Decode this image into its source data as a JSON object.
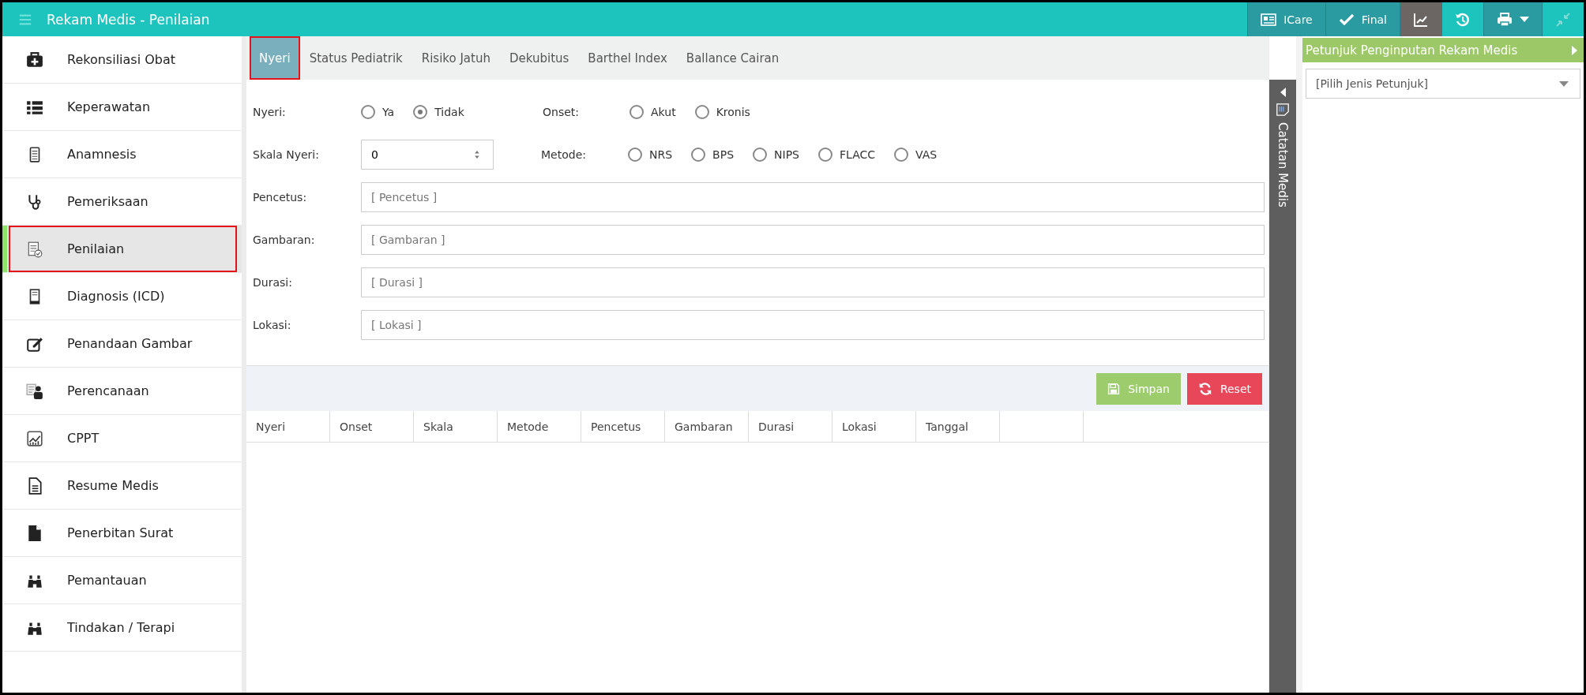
{
  "window": {
    "title": "Rekam Medis - Penilaian"
  },
  "toolbar": [
    {
      "label": "ICare",
      "selected": false
    },
    {
      "label": "Final",
      "selected": false
    },
    {
      "selected": true
    },
    {
      "selected": false
    },
    {
      "selected": false,
      "dropdown": true
    },
    {
      "selected": false
    }
  ],
  "sidebar": {
    "items": [
      {
        "label": "Rekonsiliasi Obat",
        "selected": false,
        "highlighted": false
      },
      {
        "label": "Keperawatan",
        "selected": false,
        "highlighted": false
      },
      {
        "label": "Anamnesis",
        "selected": false,
        "highlighted": false
      },
      {
        "label": "Pemeriksaan",
        "selected": false,
        "highlighted": false
      },
      {
        "label": "Penilaian",
        "selected": true,
        "highlighted": true
      },
      {
        "label": "Diagnosis (ICD)",
        "selected": false,
        "highlighted": false
      },
      {
        "label": "Penandaan Gambar",
        "selected": false,
        "highlighted": false
      },
      {
        "label": "Perencanaan",
        "selected": false,
        "highlighted": false
      },
      {
        "label": "CPPT",
        "selected": false,
        "highlighted": false
      },
      {
        "label": "Resume Medis",
        "selected": false,
        "highlighted": false
      },
      {
        "label": "Penerbitan Surat",
        "selected": false,
        "highlighted": false
      },
      {
        "label": "Pemantauan",
        "selected": false,
        "highlighted": false
      },
      {
        "label": "Tindakan / Terapi",
        "selected": false,
        "highlighted": false
      }
    ]
  },
  "tabs": [
    {
      "label": "Nyeri",
      "selected": true,
      "highlighted": true
    },
    {
      "label": "Status Pediatrik",
      "selected": false,
      "highlighted": false
    },
    {
      "label": "Risiko Jatuh",
      "selected": false,
      "highlighted": false
    },
    {
      "label": "Dekubitus",
      "selected": false,
      "highlighted": false
    },
    {
      "label": "Barthel Index",
      "selected": false,
      "highlighted": false
    },
    {
      "label": "Ballance Cairan",
      "selected": false,
      "highlighted": false
    }
  ],
  "form": {
    "nyeri": {
      "label": "Nyeri:",
      "options": [
        {
          "label": "Ya",
          "selected": false
        },
        {
          "label": "Tidak",
          "selected": true
        }
      ]
    },
    "onset": {
      "label": "Onset:",
      "options": [
        {
          "label": "Akut",
          "selected": false
        },
        {
          "label": "Kronis",
          "selected": false
        }
      ]
    },
    "skala": {
      "label": "Skala Nyeri:",
      "value": "0"
    },
    "metode": {
      "label": "Metode:",
      "options": [
        {
          "label": "NRS",
          "selected": false
        },
        {
          "label": "BPS",
          "selected": false
        },
        {
          "label": "NIPS",
          "selected": false
        },
        {
          "label": "FLACC",
          "selected": false
        },
        {
          "label": "VAS",
          "selected": false
        }
      ]
    },
    "fields": [
      {
        "label": "Pencetus:",
        "placeholder": "[ Pencetus ]"
      },
      {
        "label": "Gambaran:",
        "placeholder": "[ Gambaran ]"
      },
      {
        "label": "Durasi:",
        "placeholder": "[ Durasi ]"
      },
      {
        "label": "Lokasi:",
        "placeholder": "[ Lokasi ]"
      }
    ]
  },
  "buttons": {
    "save": "Simpan",
    "reset": "Reset"
  },
  "table": {
    "columns": [
      "Nyeri",
      "Onset",
      "Skala",
      "Metode",
      "Pencetus",
      "Gambaran",
      "Durasi",
      "Lokasi",
      "Tanggal"
    ]
  },
  "notes_panel": {
    "title": "Catatan Medis"
  },
  "guide_panel": {
    "title": "Petunjuk Penginputan Rekam Medis",
    "placeholder": "[Pilih Jenis Petunjuk]"
  }
}
